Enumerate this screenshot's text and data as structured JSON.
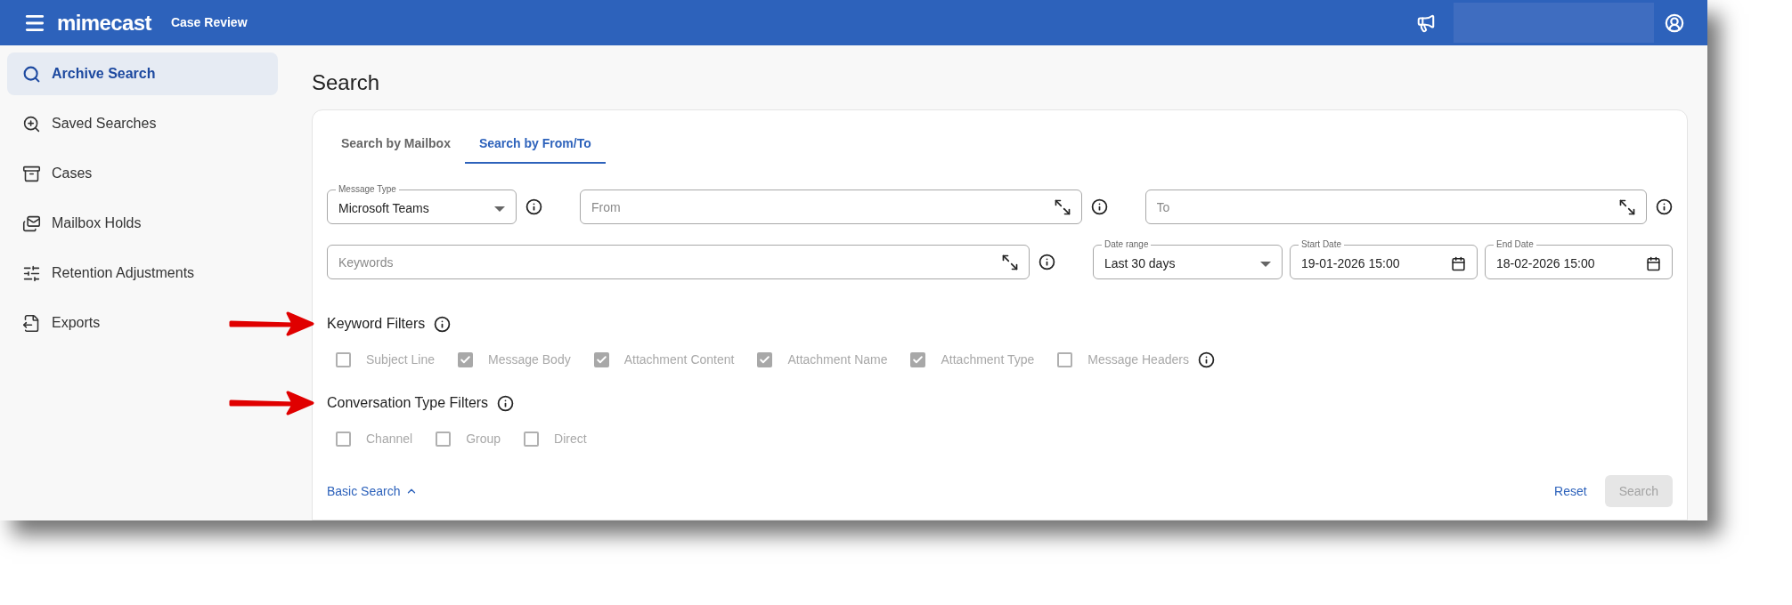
{
  "header": {
    "logo": "mimecast",
    "product": "Case Review"
  },
  "sidebar": {
    "items": [
      {
        "label": "Archive Search",
        "selected": true
      },
      {
        "label": "Saved Searches",
        "selected": false
      },
      {
        "label": "Cases",
        "selected": false
      },
      {
        "label": "Mailbox Holds",
        "selected": false
      },
      {
        "label": "Retention Adjustments",
        "selected": false
      },
      {
        "label": "Exports",
        "selected": false
      }
    ]
  },
  "page_title": "Search",
  "tabs": [
    {
      "label": "Search by Mailbox",
      "selected": false
    },
    {
      "label": "Search by From/To",
      "selected": true
    }
  ],
  "rows": [
    [
      {
        "kind": "select",
        "label": "Message Type",
        "value": "Microsoft Teams",
        "info": true
      },
      {
        "kind": "text",
        "placeholder": "From",
        "info": true
      },
      {
        "kind": "text",
        "placeholder": "To",
        "info": true
      }
    ],
    [
      {
        "kind": "text",
        "placeholder": "Keywords",
        "info": true
      },
      {
        "kind": "select",
        "label": "Date range",
        "value": "Last 30 days",
        "info": false
      },
      {
        "kind": "date",
        "label": "Start Date",
        "value": "19-01-2026 15:00",
        "info": false
      },
      {
        "kind": "date",
        "label": "End Date",
        "value": "18-02-2026 15:00",
        "info": false
      }
    ]
  ],
  "filter_sections": [
    {
      "title": "Keyword Filters",
      "marked": true,
      "options": [
        {
          "label": "Subject Line",
          "checked": false,
          "info": false
        },
        {
          "label": "Message Body",
          "checked": true,
          "info": false
        },
        {
          "label": "Attachment Content",
          "checked": true,
          "info": false
        },
        {
          "label": "Attachment Name",
          "checked": true,
          "info": false
        },
        {
          "label": "Attachment Type",
          "checked": true,
          "info": false
        },
        {
          "label": "Message Headers",
          "checked": false,
          "info": true
        }
      ]
    },
    {
      "title": "Conversation Type Filters",
      "marked": true,
      "options": [
        {
          "label": "Channel",
          "checked": false,
          "info": false
        },
        {
          "label": "Group",
          "checked": false,
          "info": false
        },
        {
          "label": "Direct",
          "checked": false,
          "info": false
        }
      ]
    }
  ],
  "footer": {
    "toggle_link": "Basic Search",
    "reset": "Reset",
    "search": {
      "label": "Search",
      "disabled": true
    }
  }
}
